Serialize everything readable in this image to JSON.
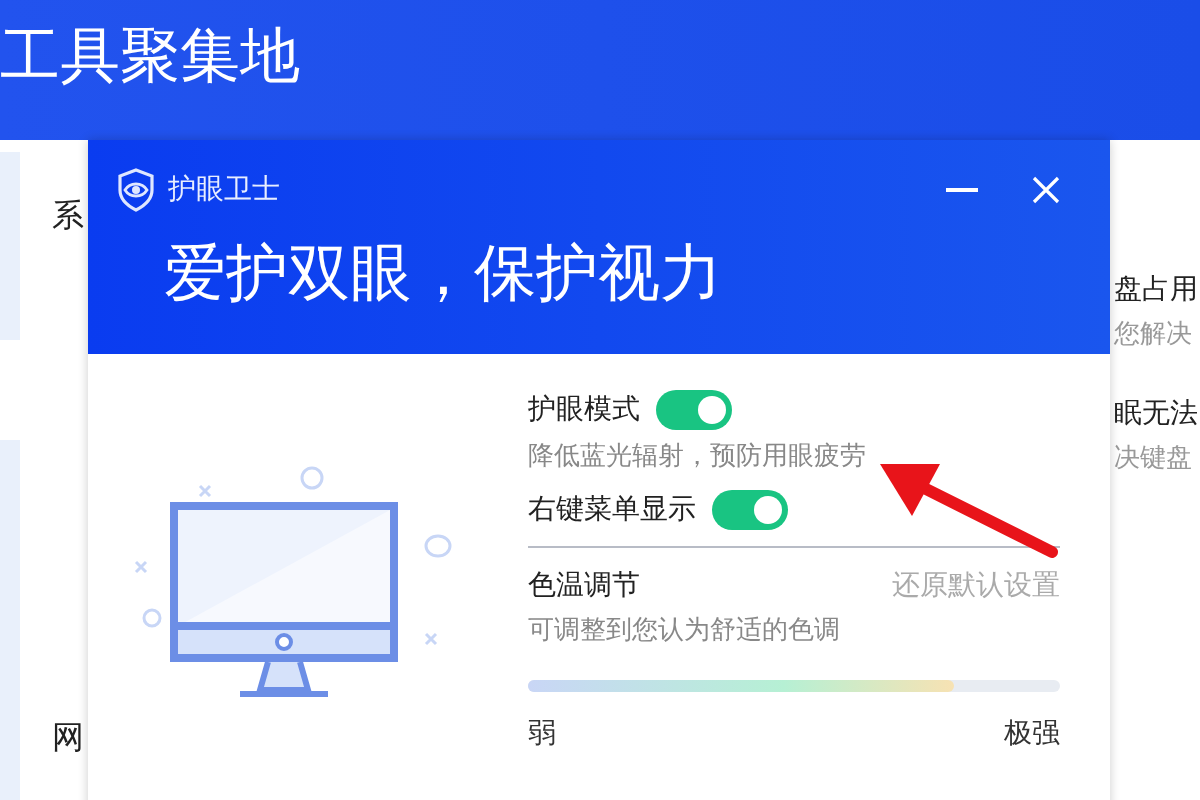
{
  "background_app": {
    "title": "工具聚集地",
    "left_labels": [
      "系",
      "网"
    ],
    "right_items": [
      {
        "title": "盘占用",
        "desc": "您解决"
      },
      {
        "title": "眠无法",
        "desc": "决键盘"
      }
    ]
  },
  "dialog": {
    "title": "护眼卫士",
    "heading": "爱护双眼，保护视力",
    "settings": [
      {
        "label": "护眼模式",
        "on": true,
        "description": "降低蓝光辐射，预防用眼疲劳"
      },
      {
        "label": "右键菜单显示",
        "on": true
      }
    ],
    "color_temperature": {
      "label": "色温调节",
      "reset_link": "还原默认设置",
      "description": "可调整到您认为舒适的色调",
      "level": 0.8,
      "min_label": "弱",
      "max_label": "极强"
    }
  }
}
